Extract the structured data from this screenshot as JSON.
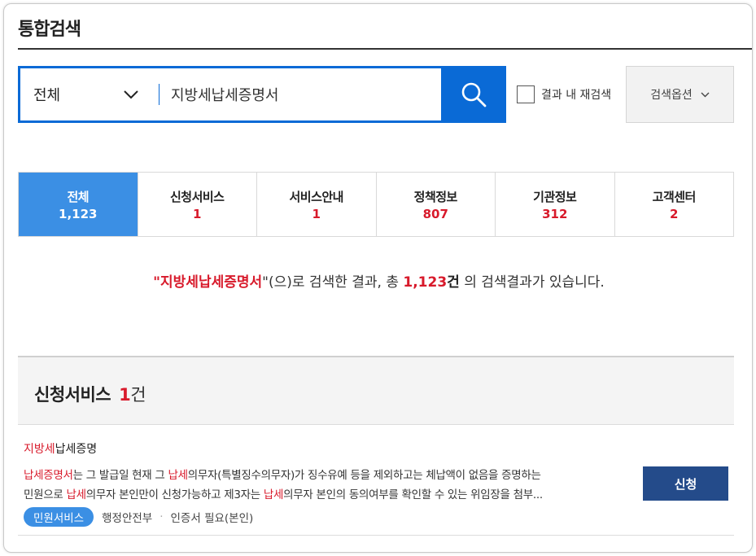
{
  "header": {
    "title": "통합검색"
  },
  "search": {
    "scope_label": "전체",
    "query": "지방세납세증명서",
    "research_label": "결과 내 재검색",
    "options_label": "검색옵션"
  },
  "tabs": [
    {
      "name": "전체",
      "count": "1,123"
    },
    {
      "name": "신청서비스",
      "count": "1"
    },
    {
      "name": "서비스안내",
      "count": "1"
    },
    {
      "name": "정책정보",
      "count": "807"
    },
    {
      "name": "기관정보",
      "count": "312"
    },
    {
      "name": "고객센터",
      "count": "2"
    }
  ],
  "summary": {
    "open_quote": "\"",
    "keyword": "지방세납세증명서",
    "close_quote": "\"",
    "text1": "(으)로 검색한 결과, 총 ",
    "total": "1,123",
    "unit": "건",
    "text2": " 의 검색결과가 있습니다."
  },
  "section": {
    "title": "신청서비스",
    "count": "1",
    "unit": "건"
  },
  "result": {
    "title_hl": "지방세",
    "title_rest": "납세증명",
    "desc_line1": [
      {
        "t": "납세증명서",
        "hl": true
      },
      {
        "t": "는 그 발급일 현재 그 ",
        "hl": false
      },
      {
        "t": "납세",
        "hl": true
      },
      {
        "t": "의무자(특별징수의무자)가 징수유예 등을 제외하고는 체납액이 없음을 증명하는",
        "hl": false
      }
    ],
    "desc_line2": [
      {
        "t": "민원으로 ",
        "hl": false
      },
      {
        "t": "납세",
        "hl": true
      },
      {
        "t": "의무자 본인만이 신청가능하고 제3자는 ",
        "hl": false
      },
      {
        "t": "납세",
        "hl": true
      },
      {
        "t": "의무자 본인의 동의여부를 확인할 수 있는 위임장을 첨부...",
        "hl": false
      }
    ],
    "badge": "민원서비스",
    "org": "행정안전부",
    "sep": "·",
    "requirement": "인증서 필요(본인)",
    "apply_label": "신청"
  },
  "colors": {
    "accent": "#0a6ad6",
    "active_tab": "#3b8fe4",
    "highlight": "#d81a2b",
    "apply_button": "#244b8a"
  },
  "icons": {
    "search": "search-icon",
    "scope_dropdown": "chevron-down-icon",
    "options_dropdown": "chevron-down-icon"
  }
}
